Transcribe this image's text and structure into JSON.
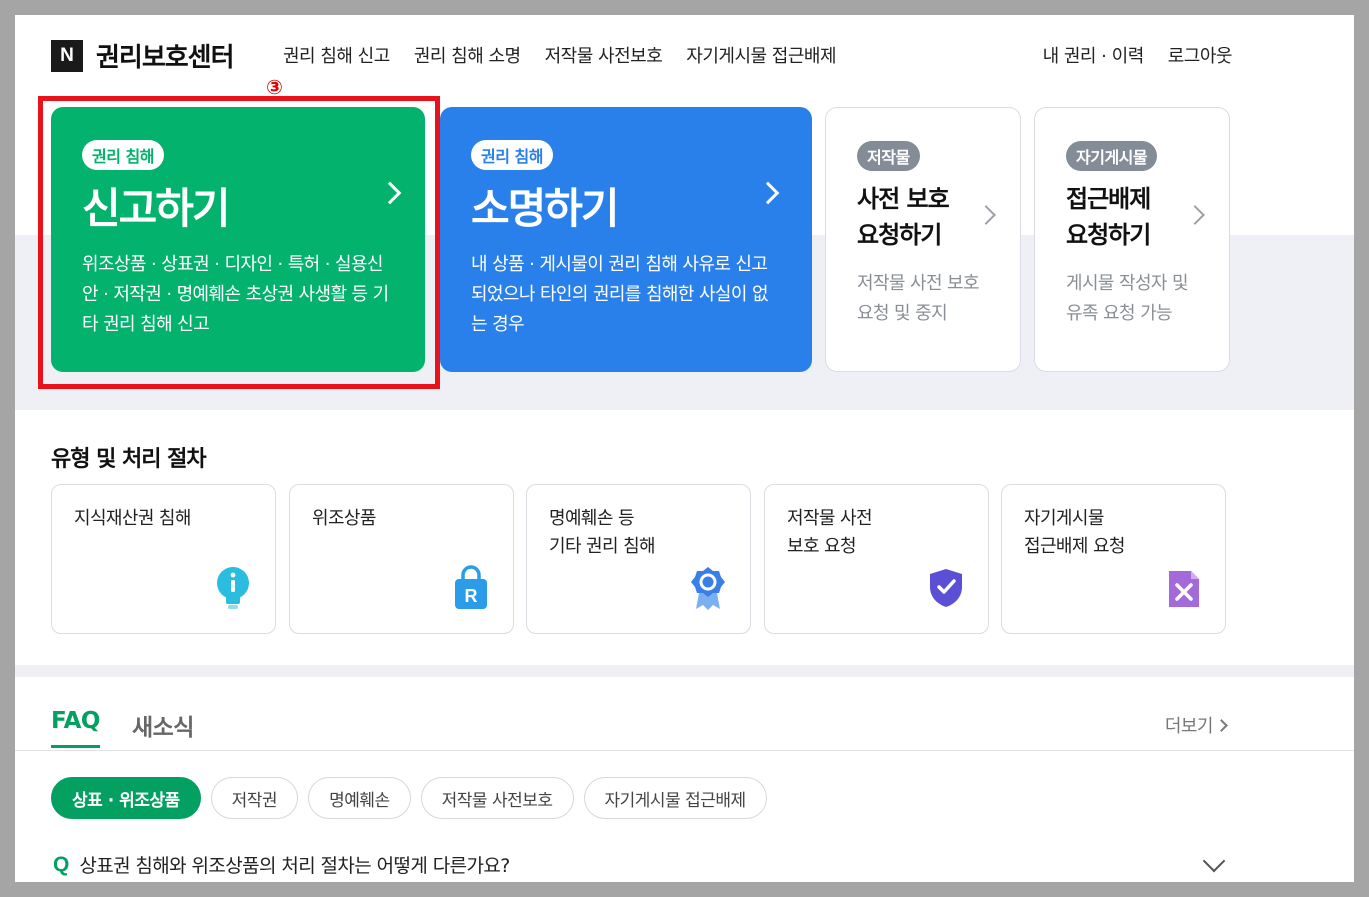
{
  "header": {
    "logo_letter": "N",
    "brand": "권리보호센터",
    "nav": [
      "권리 침해 신고",
      "권리 침해 소명",
      "저작물 사전보호",
      "자기게시물 접근배제"
    ],
    "util": [
      "내 권리 · 이력",
      "로그아웃"
    ]
  },
  "step_marker": "③",
  "cards": {
    "report": {
      "badge": "권리 침해",
      "title": "신고하기",
      "desc": "위조상품 · 상표권 · 디자인 · 특허 · 실용신안 · 저작권 · 명예훼손 초상권 사생활 등 기타 권리 침해 신고"
    },
    "explain": {
      "badge": "권리 침해",
      "title": "소명하기",
      "desc": "내 상품 · 게시물이 권리 침해 사유로 신고 되었으나 타인의 권리를 침해한 사실이 없는 경우"
    },
    "preprotect": {
      "badge": "저작물",
      "title_line1": "사전 보호",
      "title_line2": "요청하기",
      "desc_line1": "저작물 사전 보호",
      "desc_line2": "요청 및 중지"
    },
    "exclusion": {
      "badge": "자기게시물",
      "title_line1": "접근배제",
      "title_line2": "요청하기",
      "desc_line1": "게시물 작성자 및",
      "desc_line2": "유족 요청 가능"
    }
  },
  "types": {
    "title": "유형 및 처리 절차",
    "items": [
      {
        "label": "지식재산권 침해",
        "icon": "lightbulb-icon",
        "color": "#2bbde0"
      },
      {
        "label": "위조상품",
        "icon": "shopping-bag-icon",
        "color": "#2a9ce8",
        "glyph": "R"
      },
      {
        "label": "명예훼손 등\n기타 권리 침해",
        "icon": "badge-icon",
        "color": "#3a7ee8"
      },
      {
        "label": "저작물 사전\n보호 요청",
        "icon": "shield-check-icon",
        "color": "#5b4fd6"
      },
      {
        "label": "자기게시물\n접근배제 요청",
        "icon": "document-x-icon",
        "color": "#9b5ad6"
      }
    ]
  },
  "faq": {
    "tabs": [
      "FAQ",
      "새소식"
    ],
    "more": "더보기",
    "chips": [
      "상표 · 위조상품",
      "저작권",
      "명예훼손",
      "저작물 사전보호",
      "자기게시물 접근배제"
    ],
    "question_mark": "Q",
    "question": "상표권 침해와 위조상품의 처리 절차는 어떻게 다른가요?"
  },
  "colors": {
    "green": "#03b26c",
    "blue": "#2a80ea",
    "highlight": "#e8131a"
  }
}
